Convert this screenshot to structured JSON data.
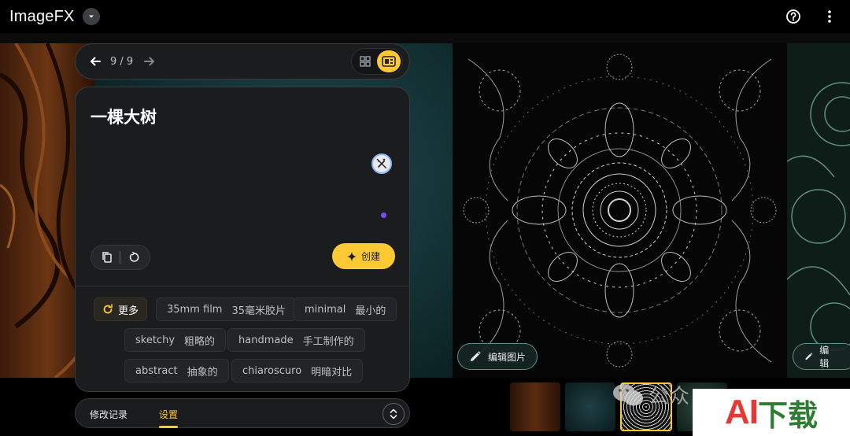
{
  "app": {
    "title": "ImageFX",
    "icons": {
      "menu": "chevron-down-icon",
      "help": "help-icon",
      "more": "more-vert-icon"
    }
  },
  "navigation": {
    "pager": "9 / 9",
    "prev_icon": "arrow-left-icon",
    "next_icon": "arrow-right-icon",
    "views": [
      {
        "icon": "grid-view-icon",
        "active": false
      },
      {
        "icon": "single-view-icon",
        "active": true
      }
    ]
  },
  "prompt": {
    "text": "一棵大树",
    "create_label": "创建",
    "tools": [
      "copy-icon",
      "reset-icon"
    ],
    "magic_icon": "magic-wand-off-icon"
  },
  "suggestions": {
    "more_label": "更多",
    "chips": [
      {
        "en": "35mm film",
        "zh": "35毫米胶片"
      },
      {
        "en": "minimal",
        "zh": "最小的"
      },
      {
        "en": "sketchy",
        "zh": "粗略的"
      },
      {
        "en": "handmade",
        "zh": "手工制作的"
      },
      {
        "en": "abstract",
        "zh": "抽象的"
      },
      {
        "en": "chiaroscuro",
        "zh": "明暗对比"
      }
    ]
  },
  "tabs": [
    {
      "label": "修改记录",
      "active": false
    },
    {
      "label": "设置",
      "active": true
    }
  ],
  "edit_image_label": "编辑图片",
  "edit_image_label_2": "编辑",
  "watermark": {
    "wechat": "公众",
    "ai_text": "AI",
    "badge_text": "下载"
  },
  "colors": {
    "accent": "#fcc934",
    "panel": "#1b1c1e",
    "border": "#3a3b3d",
    "edit_border": "#5f8f84"
  }
}
